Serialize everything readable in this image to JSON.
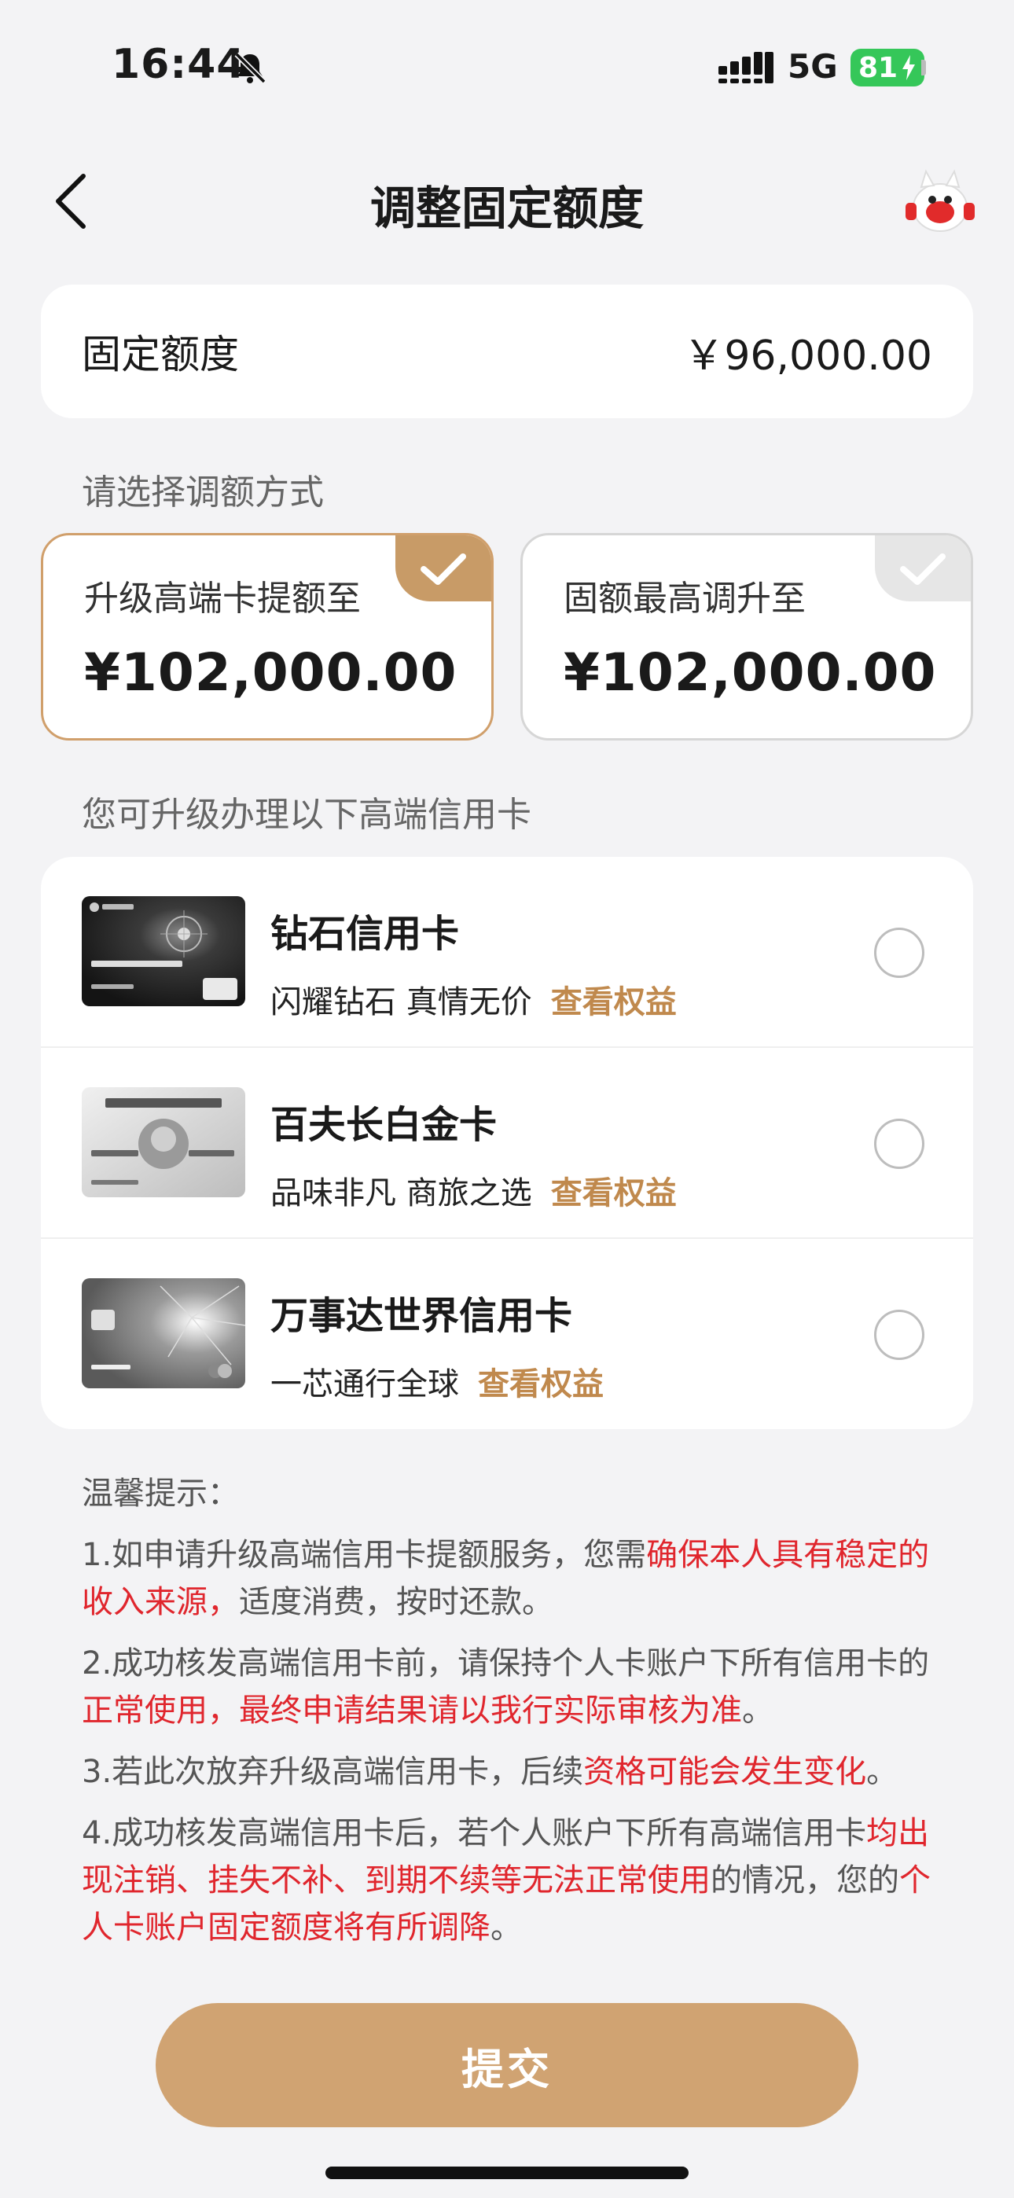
{
  "status_bar": {
    "time": "16:44",
    "network": "5G",
    "battery": "81"
  },
  "nav": {
    "title": "调整固定额度"
  },
  "quota": {
    "label": "固定额度",
    "value": "￥96,000.00"
  },
  "method": {
    "label": "请选择调额方式",
    "options": [
      {
        "title": "升级高端卡提额至",
        "value": "¥102,000.00",
        "selected": true
      },
      {
        "title": "固额最高调升至",
        "value": "¥102,000.00",
        "selected": false
      }
    ]
  },
  "cards_section": {
    "label": "您可升级办理以下高端信用卡",
    "cards": [
      {
        "name": "钻石信用卡",
        "slogan": "闪耀钻石 真情无价",
        "link": "查看权益"
      },
      {
        "name": "百夫长白金卡",
        "slogan": "品味非凡 商旅之选",
        "link": "查看权益"
      },
      {
        "name": "万事达世界信用卡",
        "slogan": "一芯通行全球",
        "link": "查看权益"
      }
    ]
  },
  "tips": {
    "title": "温馨提示：",
    "items": [
      {
        "a": "1.如申请升级高端信用卡提额服务，您需",
        "b": "确保本人具有稳定的收入来源，",
        "c": "适度消费，按时还款。"
      },
      {
        "a": "2.成功核发高端信用卡前，请保持个人卡账户下所有信用卡的",
        "b": "正常使用，最终申请结果请以我行实际审核为准",
        "c": "。"
      },
      {
        "a": "3.若此次放弃升级高端信用卡，后续",
        "b": "资格可能会发生变化",
        "c": "。"
      },
      {
        "a": "4.成功核发高端信用卡后，若个人账户下所有高端信用卡",
        "b": "均出现注销、挂失不补、到期不续等无法正常使用",
        "c": "的情况，您的",
        "d": "个人卡账户固定额度将有所调降",
        "e": "。"
      }
    ]
  },
  "submit": {
    "label": "提交"
  },
  "colors": {
    "accent": "#c89b67",
    "button": "#d0a372",
    "warning": "#e0262d",
    "link": "#c0894d"
  }
}
